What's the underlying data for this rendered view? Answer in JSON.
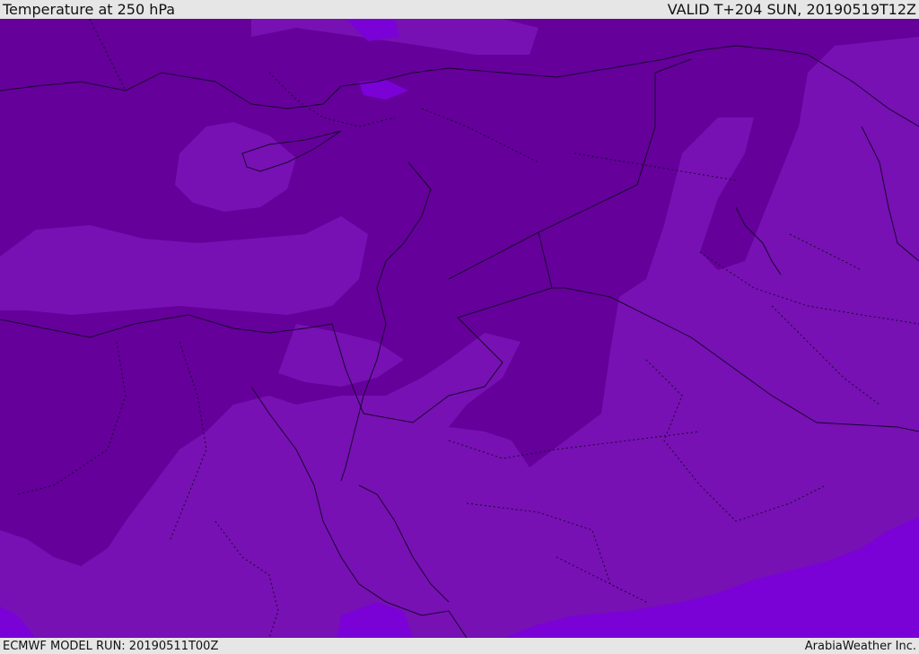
{
  "header": {
    "title": "Temperature at 250 hPa",
    "valid": "VALID T+204 SUN, 20190519T12Z"
  },
  "footer": {
    "model_run": "ECMWF MODEL RUN: 20190511T00Z",
    "credit": "ArabiaWeather Inc."
  },
  "colors": {
    "band_dark": "#65009a",
    "band_mid": "#7711b3",
    "band_light": "#7a02d6",
    "borders": "#1a0530",
    "frame": "#e6e6e6"
  }
}
